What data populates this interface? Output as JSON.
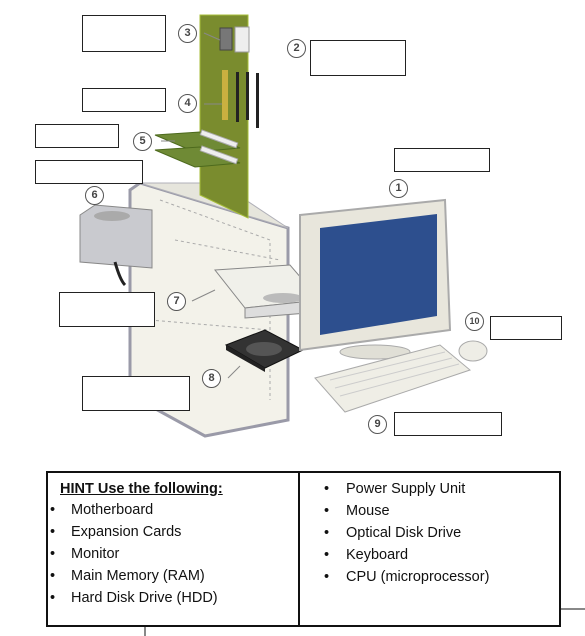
{
  "diagram": {
    "callouts": [
      "1",
      "2",
      "3",
      "4",
      "5",
      "6",
      "7",
      "8",
      "9",
      "10"
    ]
  },
  "hint": {
    "title": "HINT Use the following:",
    "left_items": [
      "Motherboard",
      "Expansion Cards",
      "Monitor",
      "Main Memory (RAM)",
      "Hard Disk Drive (HDD)"
    ],
    "right_items": [
      "Power Supply Unit",
      "Mouse",
      "Optical Disk Drive",
      "Keyboard",
      "CPU (microprocessor)"
    ]
  },
  "colors": {
    "motherboard": "#7a8c2e",
    "screen": "#2d4f8e",
    "case": "#f3f2ea"
  }
}
